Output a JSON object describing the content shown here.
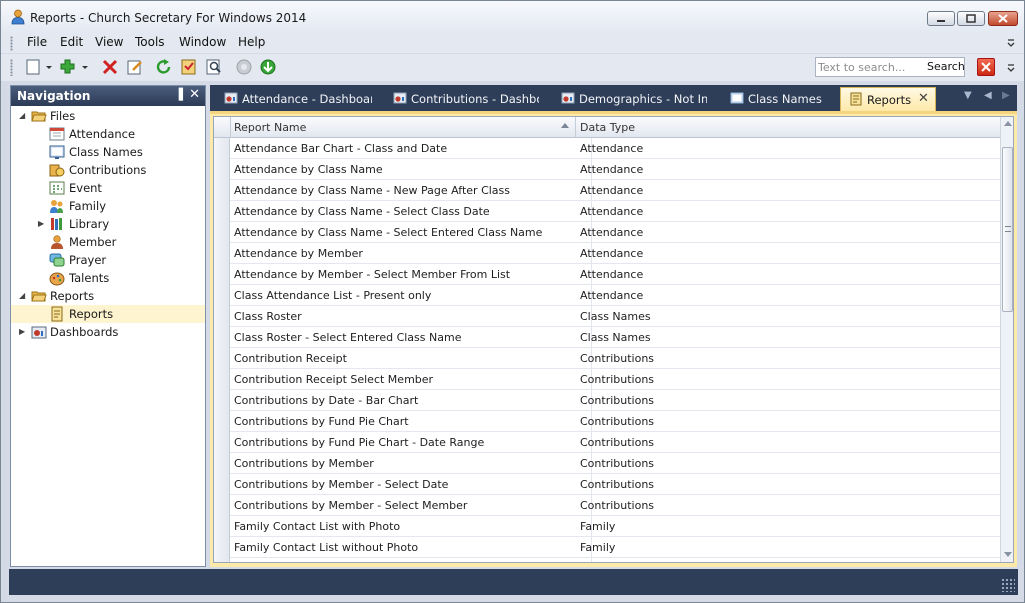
{
  "window": {
    "title": "Reports - Church Secretary For Windows 2014",
    "colors": {
      "chrome": "#d4dbe6",
      "panel_header": "#2c3a55",
      "active_tab": "#fde9a8",
      "close": "#c24a2e"
    }
  },
  "menu": [
    "File",
    "Edit",
    "View",
    "Tools",
    "Window",
    "Help"
  ],
  "toolbar": {
    "icons": [
      "new-icon",
      "dropdown-icon",
      "add-icon",
      "dropdown-icon",
      "delete-icon",
      "edit-icon",
      "refresh-icon",
      "report-icon",
      "preview-icon",
      "stop-icon",
      "go-icon"
    ],
    "search_placeholder": "Text to search...",
    "search_label": "Search"
  },
  "navigation": {
    "title": "Navigation",
    "tree": [
      {
        "label": "Files",
        "icon": "folder-open-icon",
        "expanded": true,
        "level": 0
      },
      {
        "label": "Attendance",
        "icon": "attendance-icon",
        "level": 1
      },
      {
        "label": "Class Names",
        "icon": "class-names-icon",
        "level": 1
      },
      {
        "label": "Contributions",
        "icon": "contributions-icon",
        "level": 1
      },
      {
        "label": "Event",
        "icon": "event-icon",
        "level": 1
      },
      {
        "label": "Family",
        "icon": "family-icon",
        "level": 1
      },
      {
        "label": "Library",
        "icon": "library-icon",
        "level": 1,
        "collapsed": true
      },
      {
        "label": "Member",
        "icon": "member-icon",
        "level": 1
      },
      {
        "label": "Prayer",
        "icon": "prayer-icon",
        "level": 1
      },
      {
        "label": "Talents",
        "icon": "talents-icon",
        "level": 1
      },
      {
        "label": "Reports",
        "icon": "folder-open-icon",
        "expanded": true,
        "level": 0
      },
      {
        "label": "Reports",
        "icon": "report-doc-icon",
        "level": 1,
        "selected": true
      },
      {
        "label": "Dashboards",
        "icon": "dashboard-icon",
        "level": 0,
        "collapsed": true
      }
    ]
  },
  "tabs": [
    {
      "label": "Attendance - Dashboar",
      "icon": "dashboard-icon"
    },
    {
      "label": "Contributions - Dashbo",
      "icon": "dashboard-icon"
    },
    {
      "label": "Demographics - Not Int",
      "icon": "dashboard-icon"
    },
    {
      "label": "Class Names",
      "icon": "grid-icon"
    },
    {
      "label": "Reports",
      "icon": "report-doc-icon",
      "active": true
    }
  ],
  "grid": {
    "columns": [
      "Report Name",
      "Data Type"
    ],
    "rows": [
      [
        "Attendance Bar Chart - Class and Date",
        "Attendance"
      ],
      [
        "Attendance by Class Name",
        "Attendance"
      ],
      [
        "Attendance by Class Name - New Page After Class",
        "Attendance"
      ],
      [
        "Attendance by Class Name - Select Class Date",
        "Attendance"
      ],
      [
        "Attendance by Class Name - Select Entered Class Name",
        "Attendance"
      ],
      [
        "Attendance by Member",
        "Attendance"
      ],
      [
        "Attendance by Member - Select Member From List",
        "Attendance"
      ],
      [
        "Class Attendance List - Present only",
        "Attendance"
      ],
      [
        "Class Roster",
        "Class Names"
      ],
      [
        "Class Roster - Select Entered Class Name",
        "Class Names"
      ],
      [
        "Contribution Receipt",
        "Contributions"
      ],
      [
        "Contribution Receipt Select Member",
        "Contributions"
      ],
      [
        "Contributions by Date - Bar Chart",
        "Contributions"
      ],
      [
        "Contributions by Fund Pie Chart",
        "Contributions"
      ],
      [
        "Contributions by Fund Pie Chart - Date Range",
        "Contributions"
      ],
      [
        "Contributions by Member",
        "Contributions"
      ],
      [
        "Contributions by Member - Select Date",
        "Contributions"
      ],
      [
        "Contributions by Member - Select Member",
        "Contributions"
      ],
      [
        "Family Contact List with Photo",
        "Family"
      ],
      [
        "Family Contact List without Photo",
        "Family"
      ]
    ]
  }
}
